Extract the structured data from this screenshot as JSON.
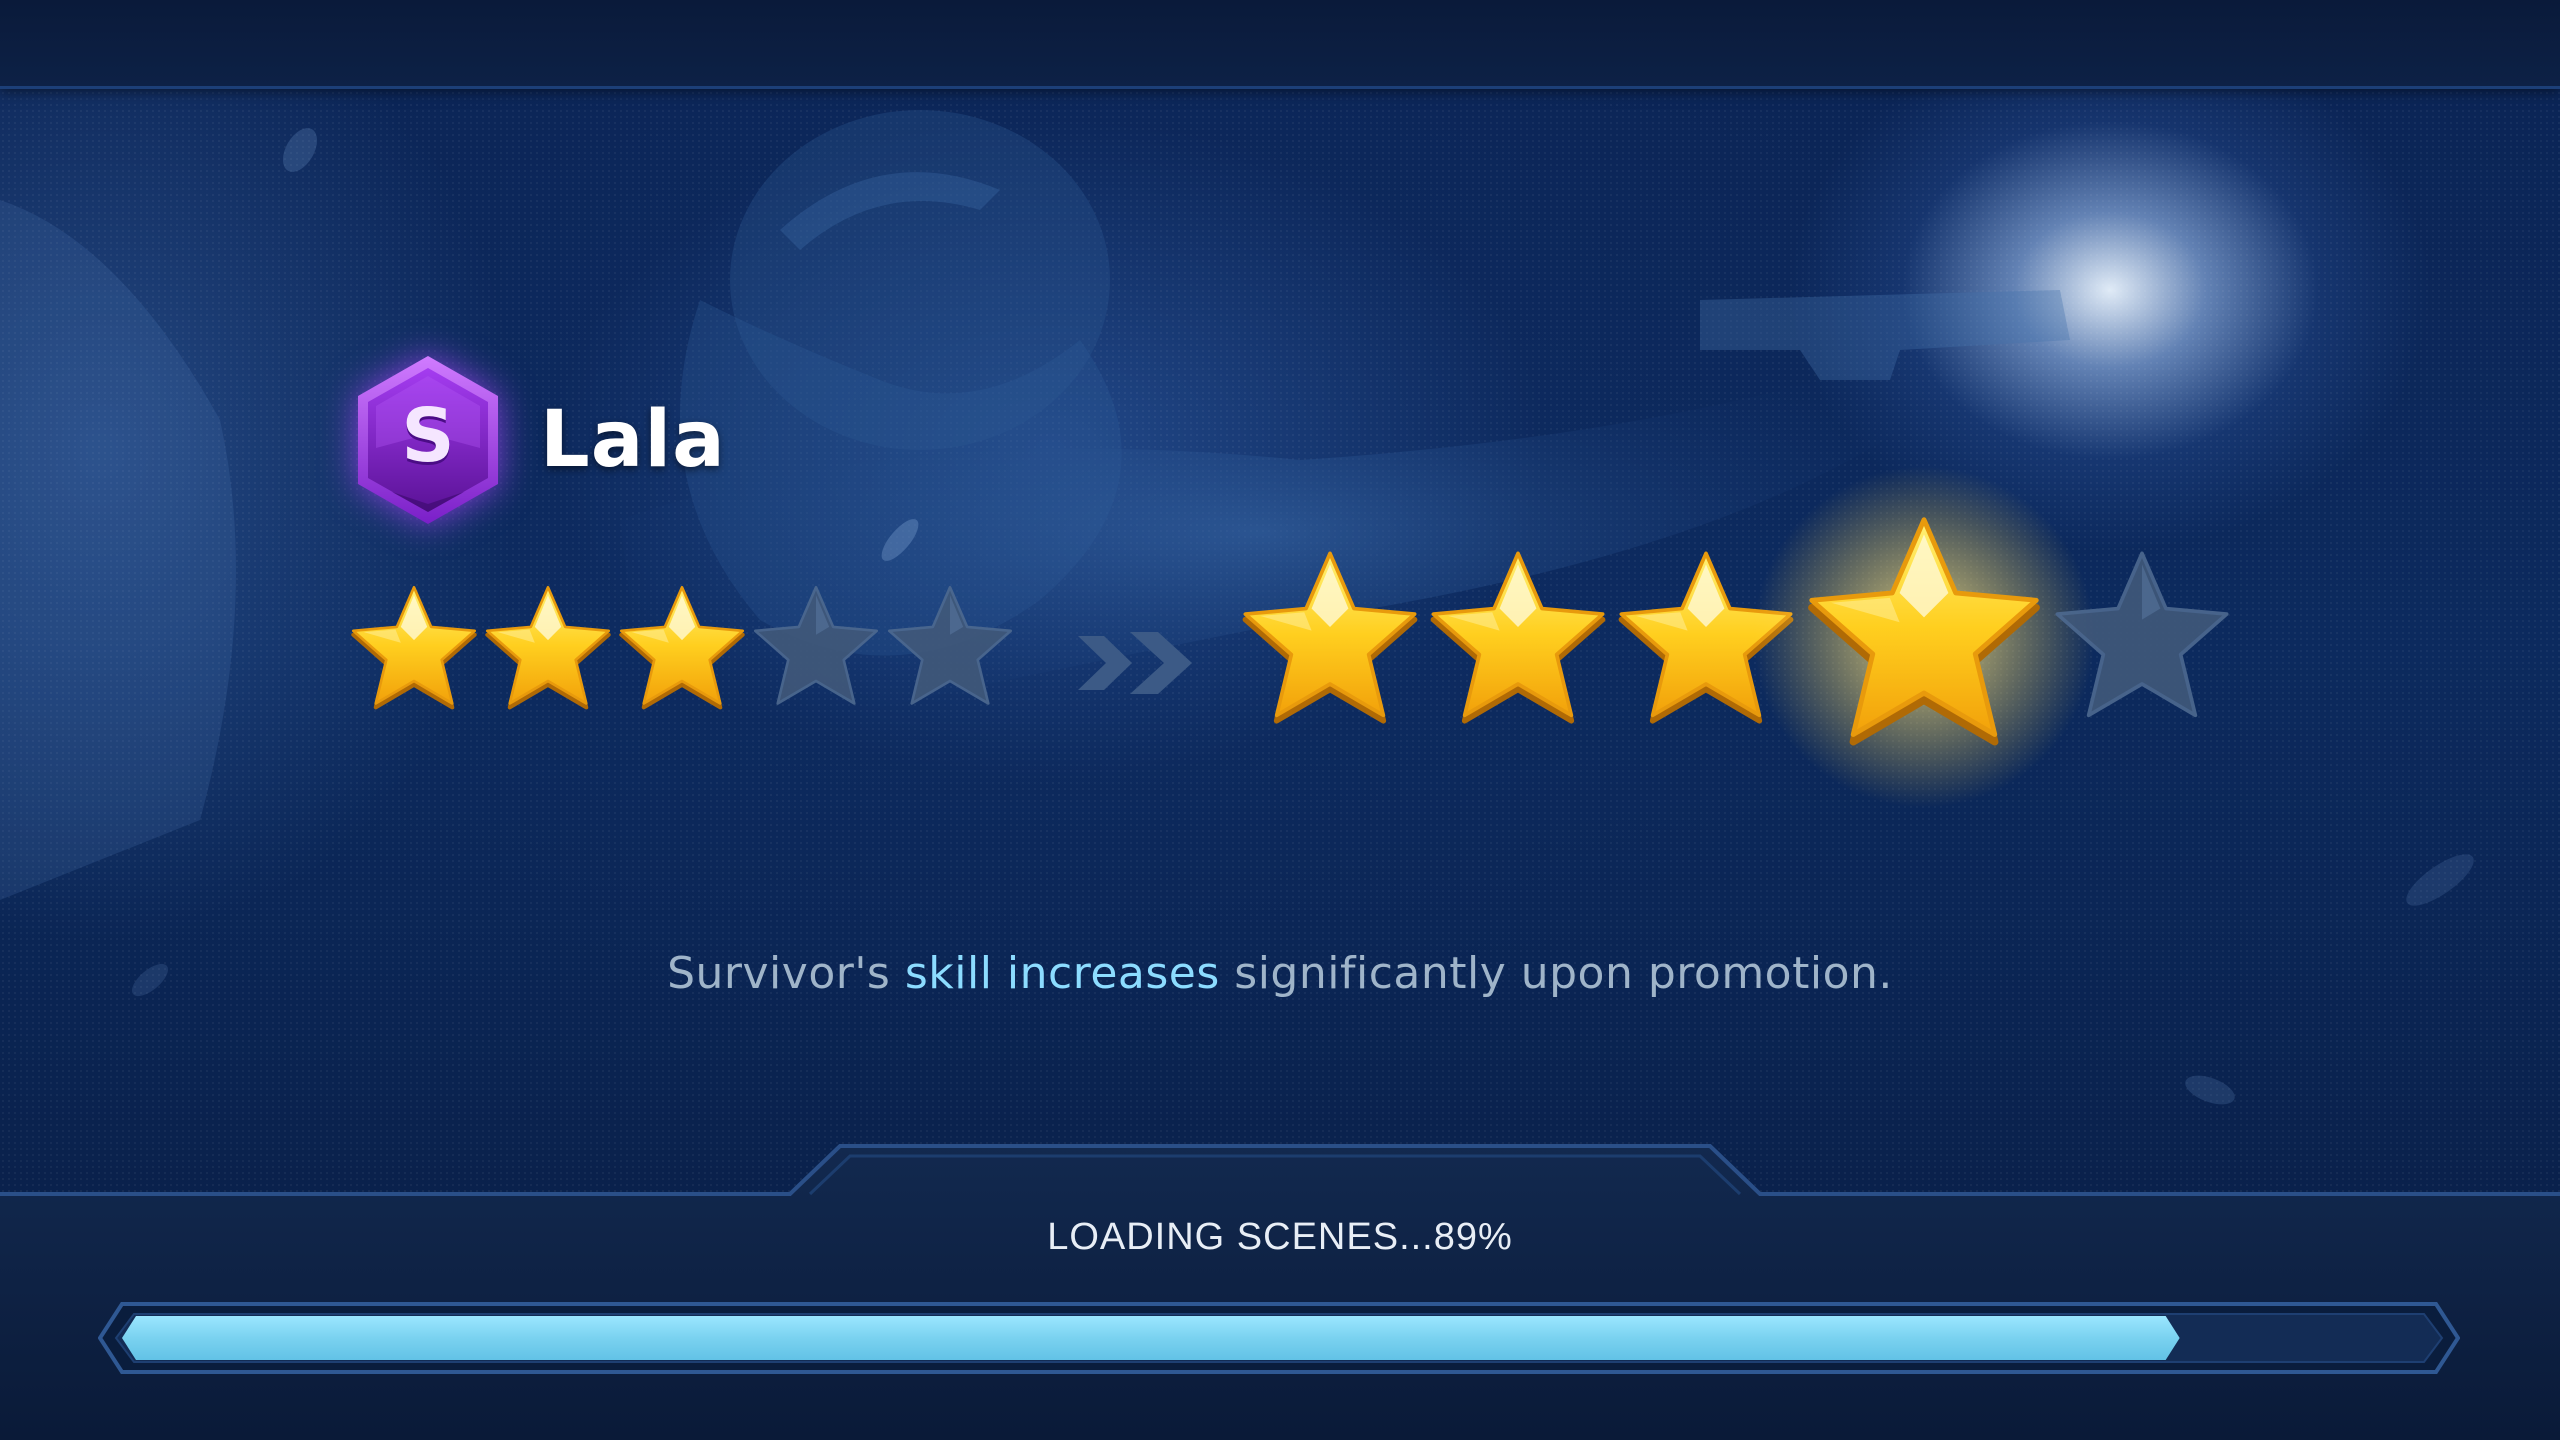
{
  "hero": {
    "rank": "S",
    "name": "Lala"
  },
  "promotion": {
    "current_stars": 3,
    "max_stars": 5,
    "next_stars": 4,
    "next_max_stars": 5
  },
  "tip": {
    "prefix": "Survivor's ",
    "highlight": "skill increases",
    "suffix": " significantly upon promotion."
  },
  "loading": {
    "label": "LOADING SCENES...89%",
    "progress": 0.89
  },
  "colors": {
    "star_gold": "#ffcf1f",
    "star_empty": "#41597a",
    "rank_purple": "#8e2fd8",
    "progress_fill": "#7ad2f0",
    "highlight_text": "#8cdcff"
  },
  "icons": {
    "rank_badge": "hexagon-rank-s-icon",
    "arrow": "double-chevron-right-icon",
    "star": "star-icon"
  }
}
